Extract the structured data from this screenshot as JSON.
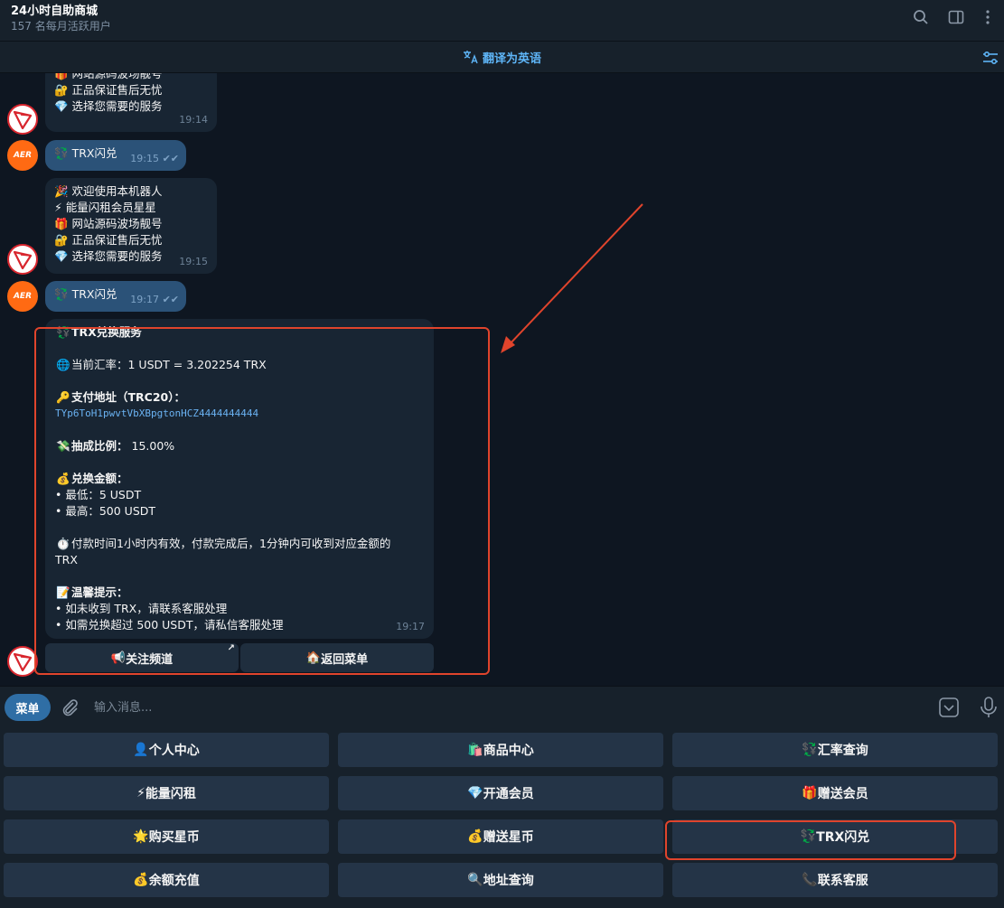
{
  "header": {
    "title": "24小时自助商城",
    "subtitle": "157 名每月活跃用户"
  },
  "translate_bar": {
    "label": "翻译为英语"
  },
  "messages": {
    "bot1_lines": [
      "🎁 网站源码波场靓号",
      "🔐 正品保证售后无忧",
      "💎 选择您需要的服务"
    ],
    "bot1_time": "19:14",
    "user1_text": "TRX闪兑",
    "user1_time": "19:15",
    "bot2_lines": [
      "🎉 欢迎使用本机器人",
      "⚡ 能量闪租会员星星",
      "🎁 网站源码波场靓号",
      "🔐 正品保证售后无忧",
      "💎 选择您需要的服务"
    ],
    "bot2_time": "19:15",
    "user2_text": "TRX闪兑",
    "user2_time": "19:17",
    "service": {
      "title": "TRX兑换服务",
      "rate": "当前汇率：1 USDT = 3.202254 TRX",
      "address_label": "支付地址（TRC20）：",
      "address": "TYp6ToH1pwvtVbXBpgtonHCZ4444444444",
      "fee_label": "抽成比例：",
      "fee_value": "15.00%",
      "amount_label": "兑换金额：",
      "min": "• 最低：5 USDT",
      "max": "• 最高：500 USDT",
      "time_note_1": "付款时间1小时内有效，付款完成后，1分钟内可收到对应金额的",
      "time_note_2": "TRX",
      "tips_label": "温馨提示：",
      "tip1": "• 如未收到 TRX，请联系客服处理",
      "tip2": "• 如需兑换超过 500 USDT，请私信客服处理",
      "time": "19:17"
    },
    "inline_buttons": {
      "follow": "关注频道",
      "back": "返回菜单"
    }
  },
  "composer": {
    "menu_label": "菜单",
    "placeholder": "输入消息..."
  },
  "keyboard": {
    "rows": [
      [
        "个人中心",
        "商品中心",
        "汇率查询"
      ],
      [
        "能量闪租",
        "开通会员",
        "赠送会员"
      ],
      [
        "购买星币",
        "赠送星币",
        "TRX闪兑"
      ],
      [
        "余额充值",
        "地址查询",
        "联系客服"
      ]
    ],
    "emojis": [
      [
        "👤",
        "🛍️",
        "💱"
      ],
      [
        "⚡",
        "💎",
        "🎁"
      ],
      [
        "🌟",
        "💰",
        "💱"
      ],
      [
        "💰",
        "🔍",
        "📞"
      ]
    ]
  },
  "colors": {
    "background": "#0e1621",
    "panel": "#17212b",
    "bubble_in": "#182533",
    "bubble_out": "#2b5278",
    "accent": "#5eb5f7",
    "annotation": "#e0442c"
  }
}
